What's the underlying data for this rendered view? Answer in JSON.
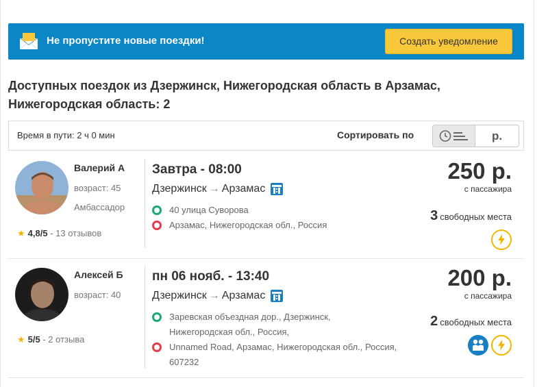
{
  "banner": {
    "text": "Не пропустите новые поездки!",
    "button": "Создать уведомление"
  },
  "heading": "Доступных поездок из Дзержинск, Нижегородская область в Арзамас, Нижегородская область: 2",
  "sortbar": {
    "travel_time": "Время в пути: 2 ч 0 мин",
    "sort_label": "Сортировать по",
    "price_option": "р."
  },
  "trips": [
    {
      "driver_name": "Валерий А",
      "driver_age": "возраст: 45",
      "driver_badge": "Амбассадор",
      "rating": "4,8/5",
      "reviews": " - 13 отзывов",
      "time": "Завтра - 08:00",
      "from": "Дзержинск",
      "arrow": "→",
      "to": "Арзамас",
      "pickup": "40 улица Суворова",
      "dropoff": "Арзамас, Нижегородская обл., Россия",
      "price": "250 р.",
      "per_passenger": "с пассажира",
      "seats_count": "3",
      "seats_label": "свободных места"
    },
    {
      "driver_name": "Алексей Б",
      "driver_age": "возраст: 40",
      "rating": "5/5",
      "reviews": " - 2 отзыва",
      "time": "пн 06 нояб. - 13:40",
      "from": "Дзержинск",
      "arrow": "→",
      "to": "Арзамас",
      "pickup": "Заревская объездная дор., Дзержинск, Нижегородская обл., Россия,",
      "dropoff": "Unnamed Road, Арзамас, Нижегородская обл., Россия, 607232",
      "price": "200 р.",
      "per_passenger": "с пассажира",
      "seats_count": "2",
      "seats_label": "свободных места"
    }
  ],
  "colors": {
    "banner": "#0b86c6",
    "button": "#f9c73a",
    "green": "#1aa874",
    "red": "#e8394c",
    "star": "#f5b400"
  }
}
